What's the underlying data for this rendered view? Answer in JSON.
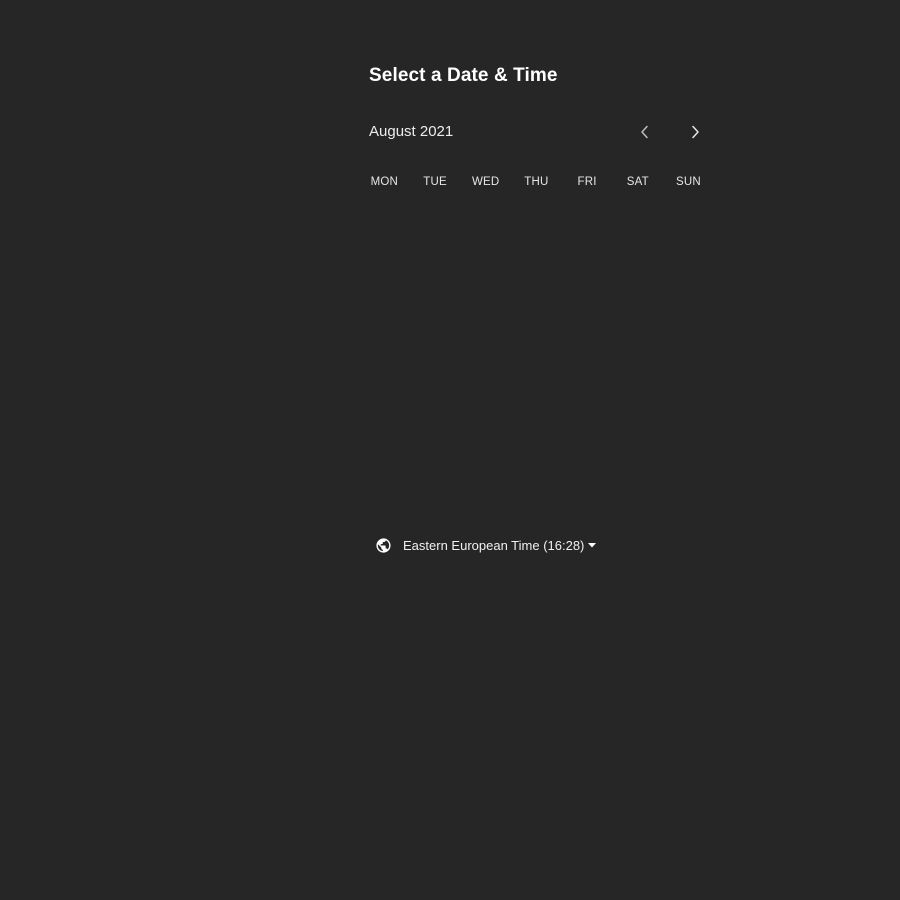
{
  "header": {
    "title": "Select a Date & Time"
  },
  "calendar": {
    "month_label": "August 2021",
    "weekdays": [
      "MON",
      "TUE",
      "WED",
      "THU",
      "FRI",
      "SAT",
      "SUN"
    ],
    "nav": {
      "prev_icon": "chevron-left-icon",
      "next_icon": "chevron-right-icon"
    }
  },
  "timezone": {
    "icon": "globe-icon",
    "label": "Eastern European Time (16:28)",
    "dropdown_icon": "caret-down-icon"
  },
  "colors": {
    "background": "#262626",
    "text": "#ffffff",
    "muted_icon": "#bdbdbd"
  }
}
